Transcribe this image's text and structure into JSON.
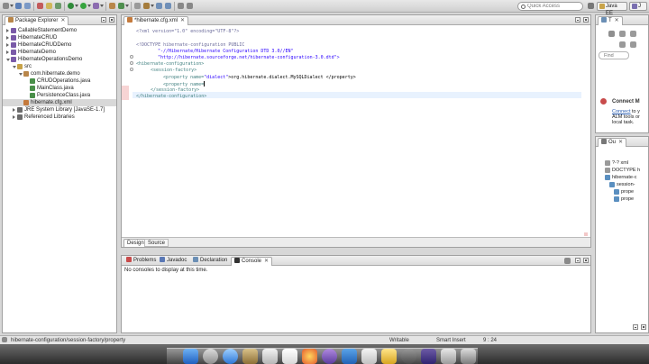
{
  "toolbar": {
    "search_placeholder": "Quick Access",
    "perspective_label": "Java EE",
    "perspective2_label": "J"
  },
  "package_explorer": {
    "tab_label": "Package Explorer",
    "tree": [
      {
        "label": "CallableStatementDemo",
        "depth": 0,
        "open": false
      },
      {
        "label": "HibernateCRUD",
        "depth": 0,
        "open": false
      },
      {
        "label": "HibernateCRUDDemo",
        "depth": 0,
        "open": false
      },
      {
        "label": "HibernateDemo",
        "depth": 0,
        "open": false
      },
      {
        "label": "HibernateOperationsDemo",
        "depth": 0,
        "open": true
      },
      {
        "label": "src",
        "depth": 1,
        "open": true
      },
      {
        "label": "com.hibernate.demo",
        "depth": 2,
        "open": true
      },
      {
        "label": "CRUDOperations.java",
        "depth": 3,
        "open": false
      },
      {
        "label": "MainClass.java",
        "depth": 3,
        "open": false
      },
      {
        "label": "PersistenceClass.java",
        "depth": 3,
        "open": false
      },
      {
        "label": "hibernate.cfg.xml",
        "depth": 2,
        "open": false
      },
      {
        "label": "JRE System Library [JavaSE-1.7]",
        "depth": 1,
        "open": false
      },
      {
        "label": "Referenced Libraries",
        "depth": 1,
        "open": false
      }
    ]
  },
  "editor": {
    "tab_label": "*hibernate.cfg.xml",
    "bottom_tabs": [
      "Design",
      "Source"
    ],
    "lines": {
      "l1": "<?xml version=\"1.0\" encoding=\"UTF-8\"?>",
      "l2": "<!DOCTYPE hibernate-configuration PUBLIC",
      "l3": "\"-//Hibernate/Hibernate Configuration DTD 3.0//EN\"",
      "l4": "\"http://hibernate.sourceforge.net/hibernate-configuration-3.0.dtd\">",
      "l5": "<hibernate-configuration>",
      "l6": "<session-factory>",
      "l7a": "<property name=",
      "l7b": "\"dialect\"",
      "l7c": ">org.hibernate.dialect.MySQLDialect </property>",
      "l8": "<property name=",
      "l9": "</session-factory>",
      "l10": "</hibernate-configuration>"
    }
  },
  "console": {
    "tabs": [
      "Problems",
      "Javadoc",
      "Declaration",
      "Console"
    ],
    "message": "No consoles to display at this time."
  },
  "task_list": {
    "tab_label": "T",
    "find_placeholder": "Find",
    "connect_title": "Connect M",
    "connect_link": "Connect",
    "connect_text1": "to y",
    "connect_text2": "ALM tools or",
    "connect_text3": "local task."
  },
  "outline": {
    "tab_label": "Ou",
    "items": [
      "?-? xml",
      "DOCTYPE h",
      "hibernate-c",
      "session-",
      "prope",
      "prope"
    ]
  },
  "statusbar": {
    "path": "hibernate-configuration/session-factory/property",
    "mode": "Writable",
    "insert": "Smart Insert",
    "position": "9 : 24"
  }
}
